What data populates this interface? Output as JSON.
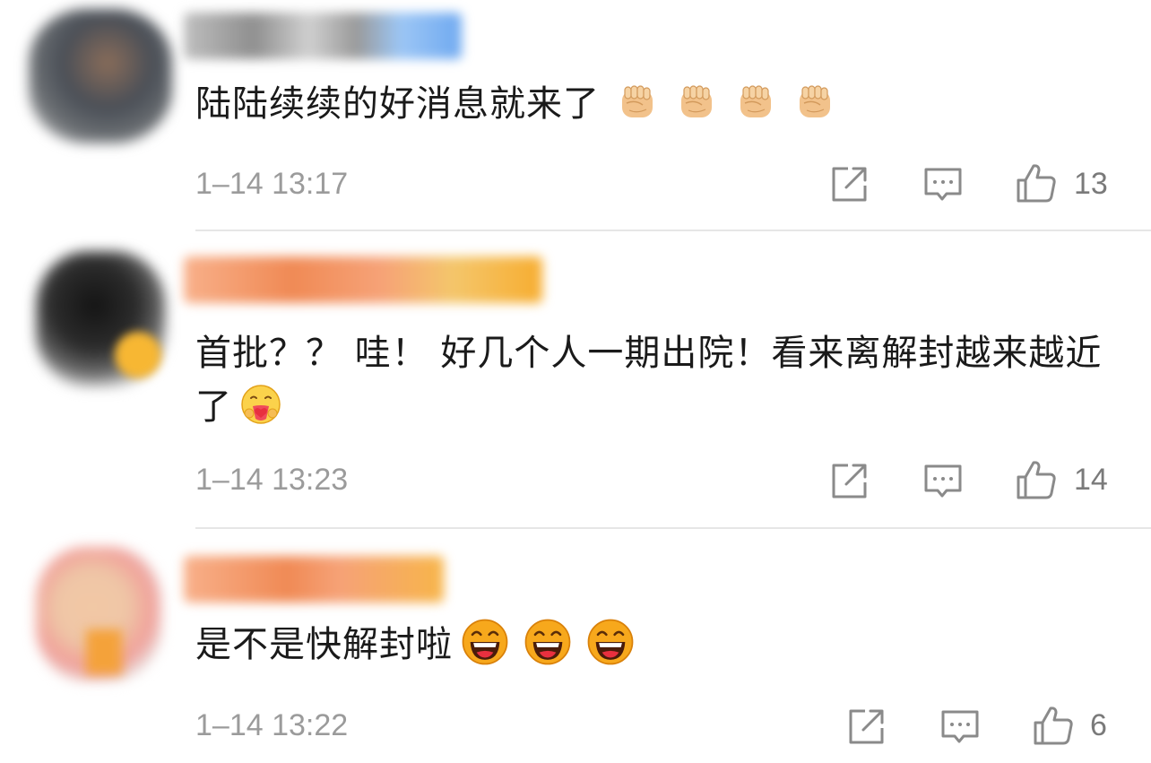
{
  "comments": [
    {
      "text": "陆陆续续的好消息就来了",
      "emoji_icon": "raised-fist-emoji",
      "emoji_count": 4,
      "timestamp": "1–14 13:17",
      "likes": "13"
    },
    {
      "text": "首批？？ 哇！  好几个人一期出院！看来离解封越来越近了",
      "emoji_icon": "hugging-face-emoji",
      "emoji_count": 1,
      "timestamp": "1–14 13:23",
      "likes": "14"
    },
    {
      "text": "是不是快解封啦",
      "emoji_icon": "laughing-face-emoji",
      "emoji_count": 3,
      "timestamp": "1–14 13:22",
      "likes": "6"
    }
  ],
  "action_icons": [
    "share-icon",
    "reply-icon",
    "like-icon"
  ],
  "colors": {
    "text": "#1a1a1a",
    "meta": "#9b9b9b",
    "icon": "#8a8a8a",
    "divider": "#e6e6e6"
  }
}
